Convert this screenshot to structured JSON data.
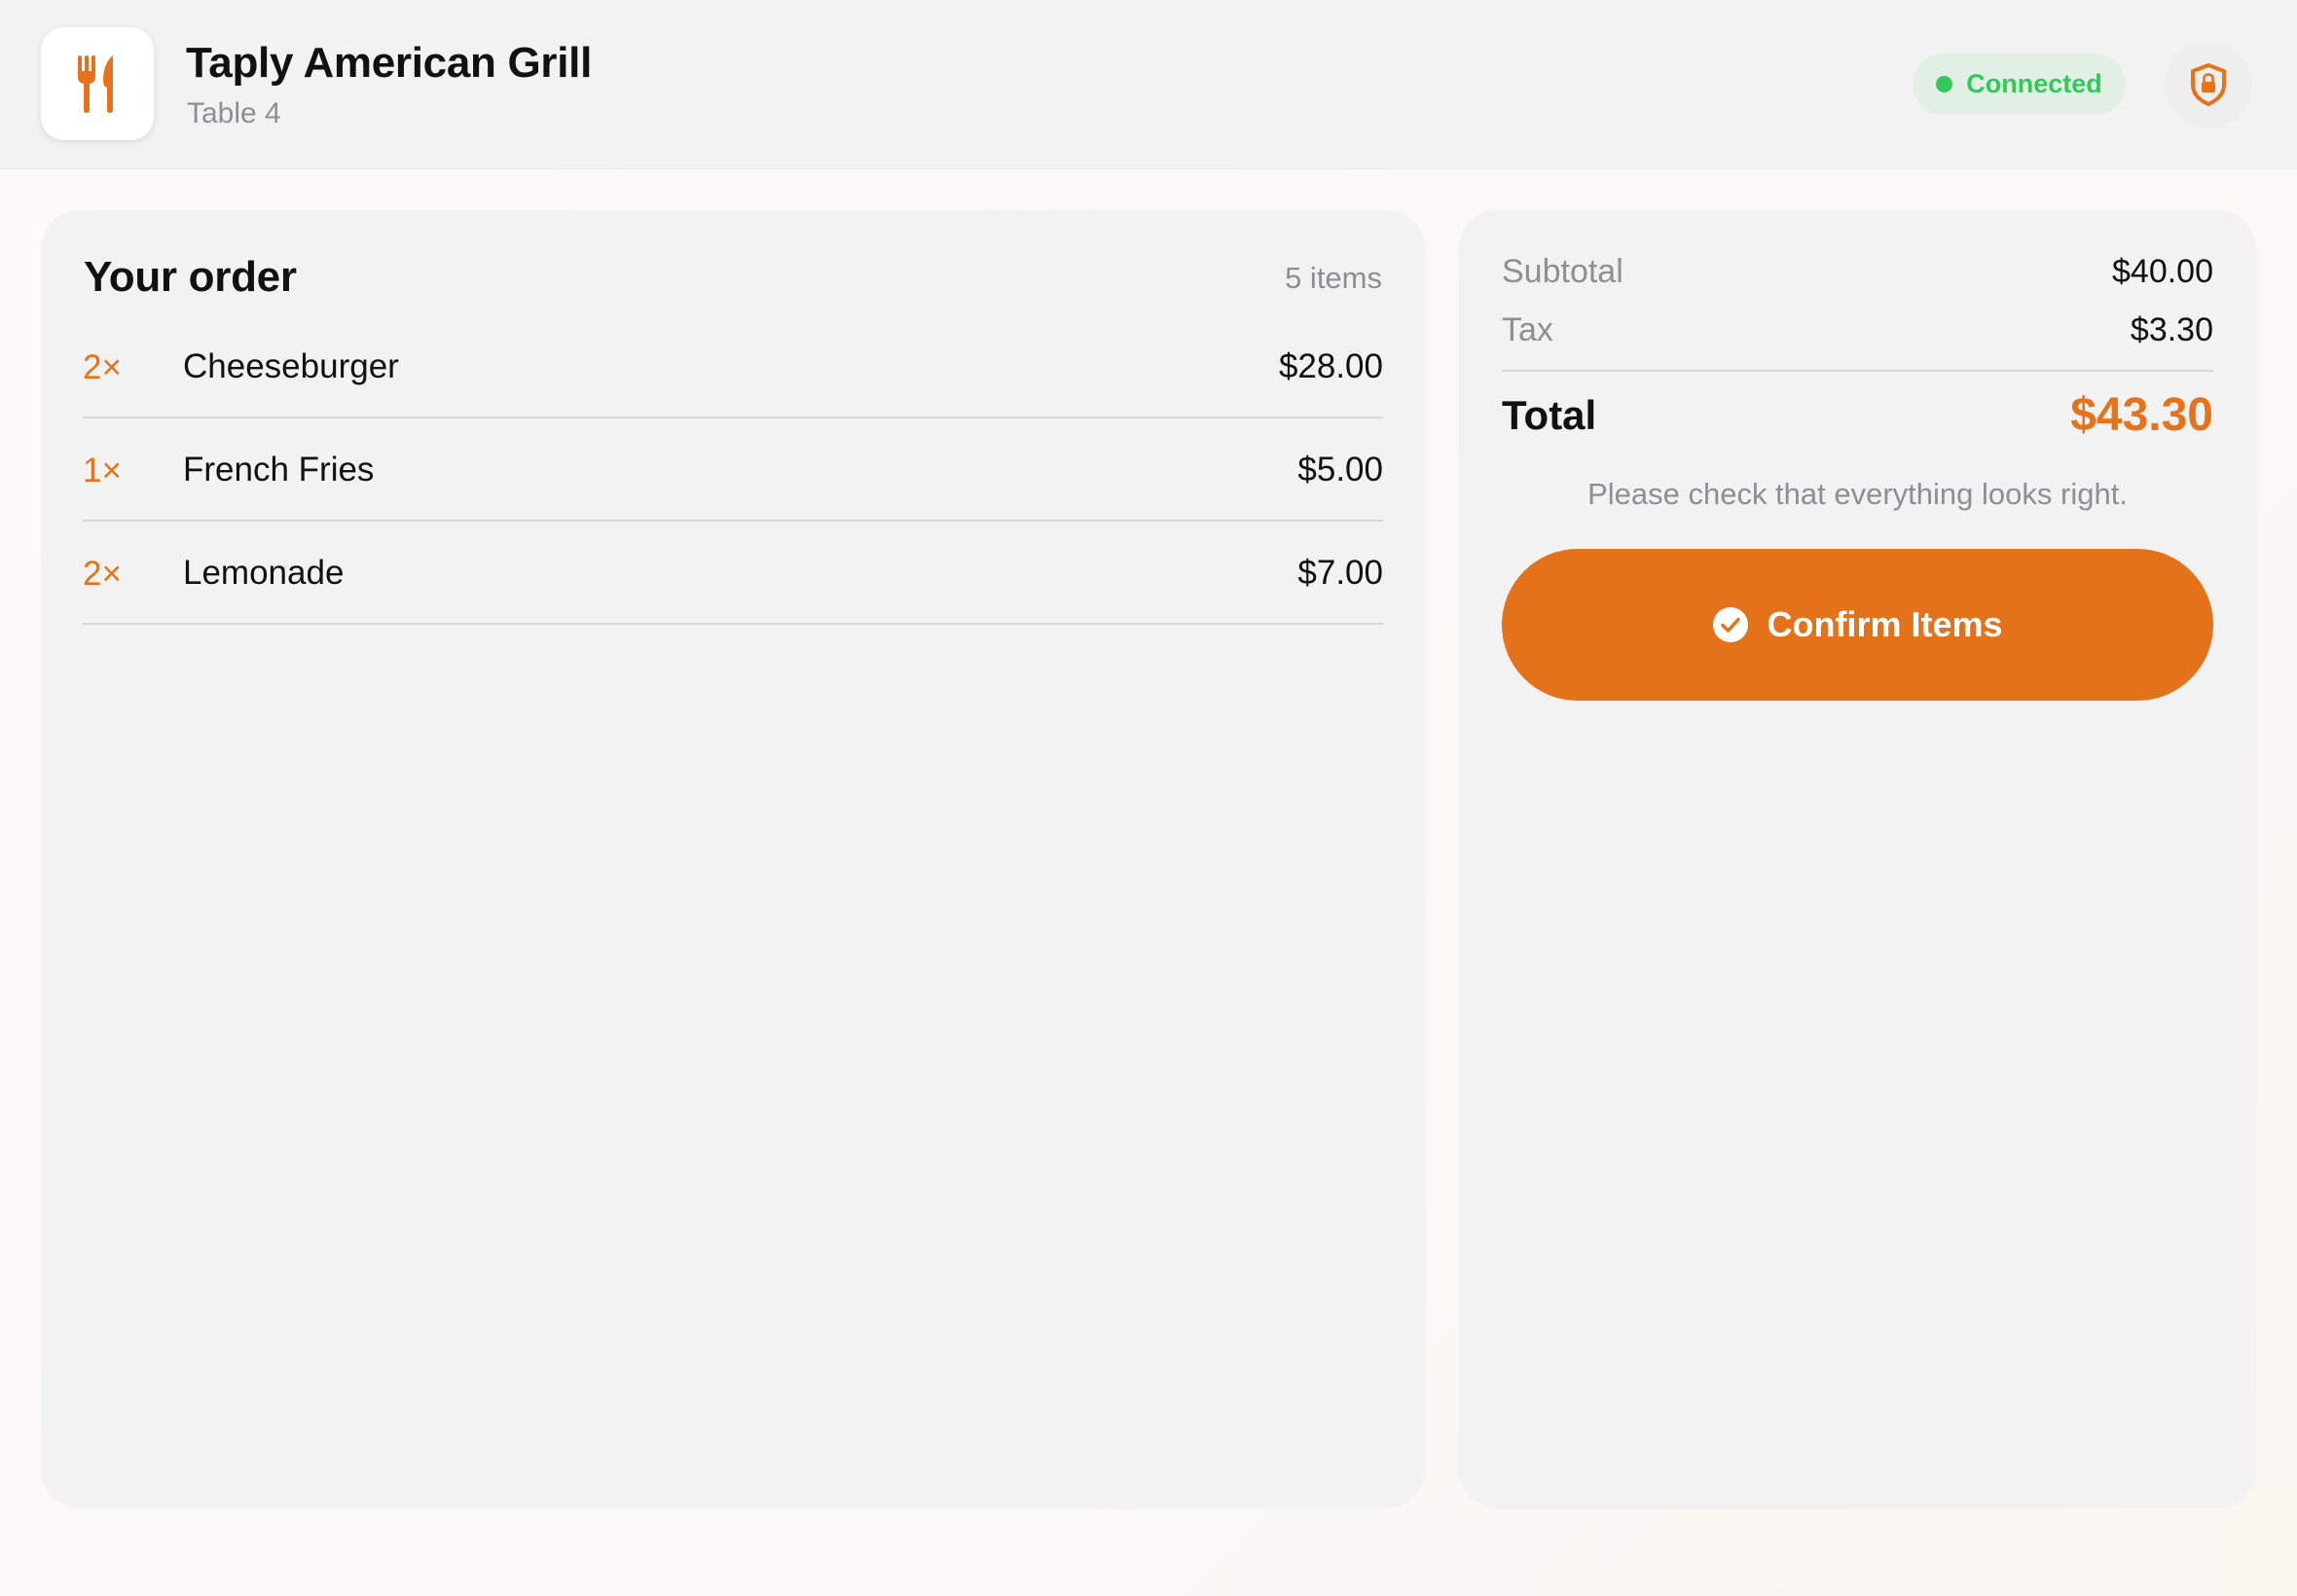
{
  "header": {
    "title": "Taply American Grill",
    "subtitle": "Table 4",
    "status": {
      "label": "Connected",
      "color": "#34c759"
    },
    "app_icon": "fork-knife-icon",
    "security_icon": "shield-lock-icon"
  },
  "colors": {
    "accent": "#e4721a",
    "success": "#34c759",
    "muted": "#8e8e93"
  },
  "order": {
    "title": "Your order",
    "count": "5 items",
    "items": [
      {
        "qty": "2×",
        "name": "Cheeseburger",
        "price": "$28.00"
      },
      {
        "qty": "1×",
        "name": "French Fries",
        "price": "$5.00"
      },
      {
        "qty": "2×",
        "name": "Lemonade",
        "price": "$7.00"
      }
    ]
  },
  "summary": {
    "subtotal_label": "Subtotal",
    "subtotal_value": "$40.00",
    "tax_label": "Tax",
    "tax_value": "$3.30",
    "total_label": "Total",
    "total_value": "$43.30",
    "note": "Please check that everything looks right.",
    "confirm_label": "Confirm Items",
    "confirm_icon": "checkmark-circle-icon"
  }
}
